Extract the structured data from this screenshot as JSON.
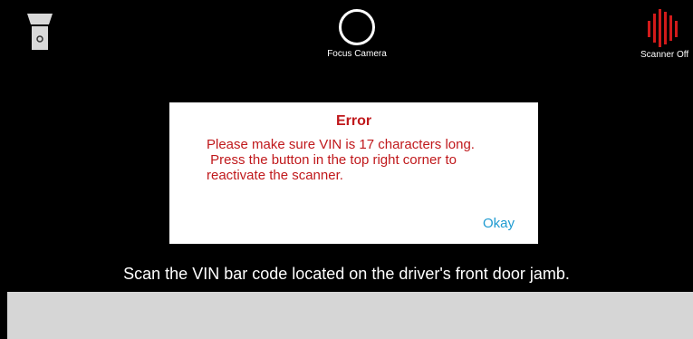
{
  "camera_controls": {
    "flashlight": {
      "icon": "flashlight-icon"
    },
    "focus": {
      "label": "Focus Camera",
      "icon": "focus-ring-icon"
    },
    "scanner": {
      "label": "Scanner Off",
      "icon": "scanner-barcode-icon"
    }
  },
  "dialog": {
    "title": "Error",
    "message": "Please make sure VIN is 17 characters long.\n Press the button in the top right corner to reactivate the scanner.",
    "ok_label": "Okay"
  },
  "instruction": "Scan the VIN bar code located on the driver's front door jamb.",
  "colors": {
    "error_red": "#c0191c",
    "link_blue": "#1f9bd1",
    "scanner_red": "#d11a1a",
    "background": "#000000",
    "panel_gray": "#d6d6d6"
  }
}
